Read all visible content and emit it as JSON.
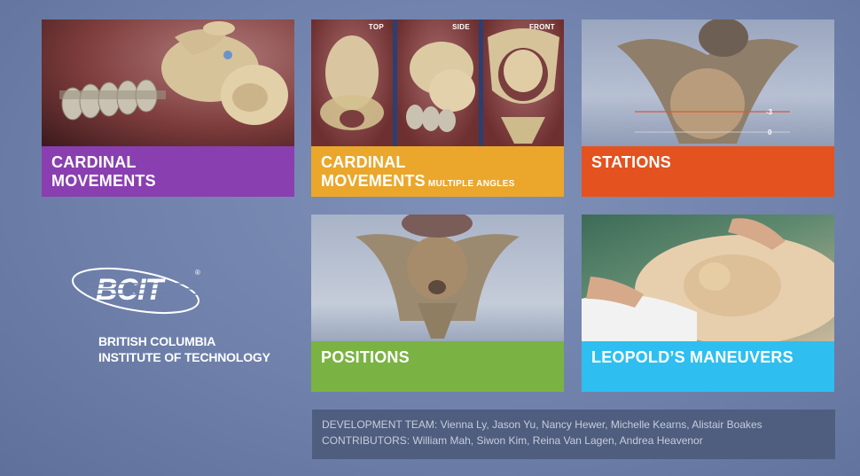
{
  "tiles": {
    "cardinal": {
      "label_line1": "CARDINAL",
      "label_line2": "MOVEMENTS",
      "color": "#8a3fb0"
    },
    "cardinal_multi": {
      "label_line1": "CARDINAL",
      "label_line2": "MOVEMENTS",
      "label_small": "MULTIPLE ANGLES",
      "color": "#eaa72c",
      "views": [
        "TOP",
        "SIDE",
        "FRONT"
      ]
    },
    "stations": {
      "label": "STATIONS",
      "color": "#e4521f",
      "markers": [
        "-3",
        "0"
      ]
    },
    "positions": {
      "label": "POSITIONS",
      "color": "#7ab343"
    },
    "leopold": {
      "label": "LEOPOLD’S MANEUVERS",
      "color": "#2ebff0"
    }
  },
  "logo": {
    "name_line1": "BRITISH COLUMBIA",
    "name_line2": "INSTITUTE OF TECHNOLOGY"
  },
  "credits": {
    "development": "DEVELOPMENT TEAM: Vienna Ly, Jason Yu, Nancy Hewer, Michelle Kearns, Alistair Boakes",
    "contributors": "CONTRIBUTORS: William Mah, Siwon Kim, Reina Van Lagen, Andrea Heavenor"
  }
}
